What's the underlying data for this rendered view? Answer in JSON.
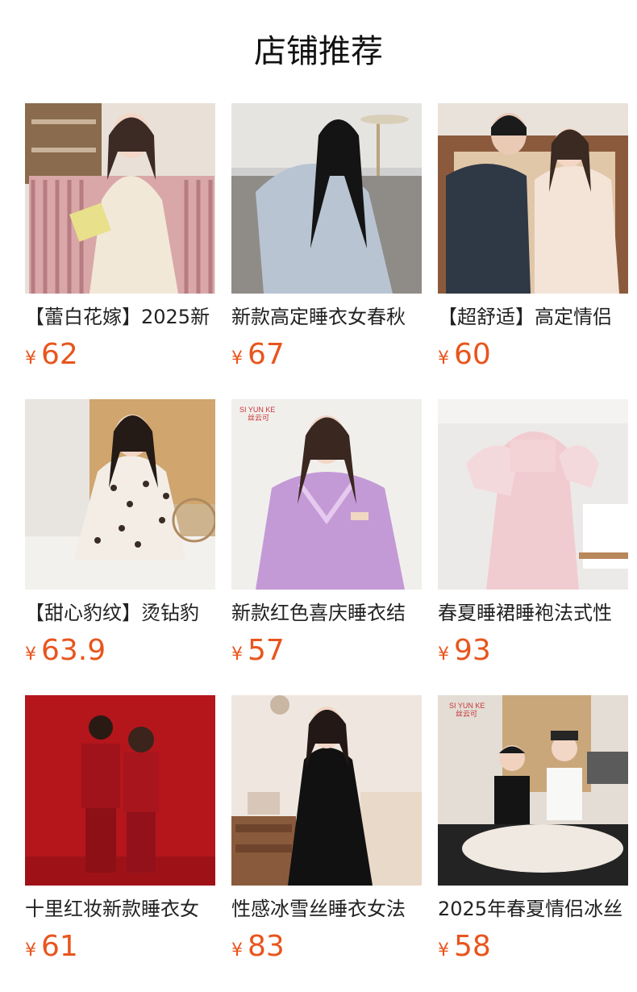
{
  "header": {
    "title": "店铺推荐"
  },
  "currency_symbol": "¥",
  "colors": {
    "price": "#e8551d",
    "title": "#111111"
  },
  "products": [
    {
      "name": "【蕾白花嫁】2025新",
      "price": "62"
    },
    {
      "name": "新款高定睡衣女春秋",
      "price": "67"
    },
    {
      "name": "【超舒适】高定情侣",
      "price": "60"
    },
    {
      "name": "【甜心豹纹】烫钻豹",
      "price": "63.9"
    },
    {
      "name": "新款红色喜庆睡衣结",
      "price": "57"
    },
    {
      "name": "春夏睡裙睡袍法式性",
      "price": "93"
    },
    {
      "name": "十里红妆新款睡衣女",
      "price": "61"
    },
    {
      "name": "性感冰雪丝睡衣女法",
      "price": "83"
    },
    {
      "name": "2025年春夏情侣冰丝",
      "price": "58"
    }
  ],
  "logos": {
    "brand_en": "SI YUN KE",
    "brand_cn": "丝云可"
  }
}
